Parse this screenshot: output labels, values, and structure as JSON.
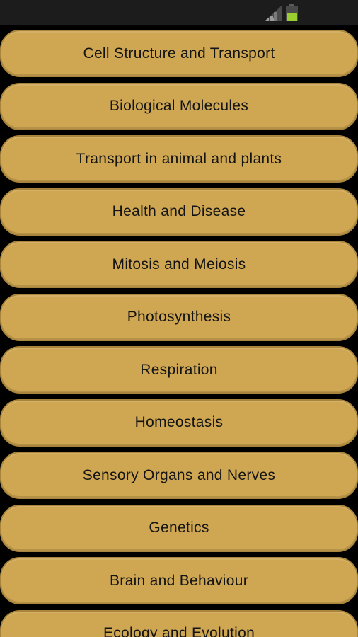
{
  "status_bar": {
    "signal_icon": "cellular-signal-icon",
    "battery_icon": "battery-icon",
    "battery_color": "#9acd32"
  },
  "colors": {
    "background": "#000000",
    "button_fill": "#cfa753",
    "button_border": "#a9853c",
    "text": "#141414"
  },
  "topics": [
    {
      "label": "Cell Structure and Transport"
    },
    {
      "label": "Biological Molecules"
    },
    {
      "label": "Transport in animal and plants"
    },
    {
      "label": "Health and Disease"
    },
    {
      "label": "Mitosis and Meiosis"
    },
    {
      "label": "Photosynthesis"
    },
    {
      "label": "Respiration"
    },
    {
      "label": "Homeostasis"
    },
    {
      "label": "Sensory Organs and Nerves"
    },
    {
      "label": "Genetics"
    },
    {
      "label": "Brain and Behaviour"
    },
    {
      "label": "Ecology and Evolution"
    }
  ]
}
